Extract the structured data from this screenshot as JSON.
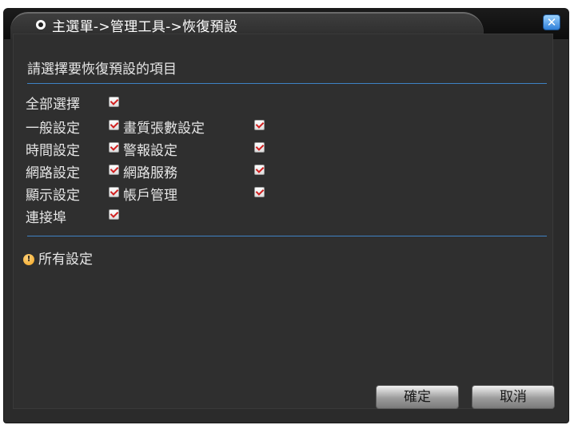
{
  "window": {
    "title": "主選單->管理工具->恢復預設",
    "close_label": "✕"
  },
  "heading": "請選擇要恢復預設的項目",
  "options": {
    "select_all": {
      "label": "全部選擇",
      "checked": true
    },
    "left": [
      {
        "label": "一般設定",
        "checked": true
      },
      {
        "label": "時間設定",
        "checked": true
      },
      {
        "label": "網路設定",
        "checked": true
      },
      {
        "label": "顯示設定",
        "checked": true
      },
      {
        "label": "連接埠",
        "checked": true
      }
    ],
    "right": [
      {
        "label": "畫質張數設定",
        "checked": true
      },
      {
        "label": "警報設定",
        "checked": true
      },
      {
        "label": "網路服務",
        "checked": true
      },
      {
        "label": "帳戶管理",
        "checked": true
      }
    ]
  },
  "info": {
    "icon_label": "!",
    "text": "所有設定"
  },
  "buttons": {
    "confirm": "確定",
    "cancel": "取消"
  },
  "colors": {
    "accent_line": "#3e82c4",
    "check_mark": "#d11f1f",
    "info_icon": "#f2a21b"
  }
}
